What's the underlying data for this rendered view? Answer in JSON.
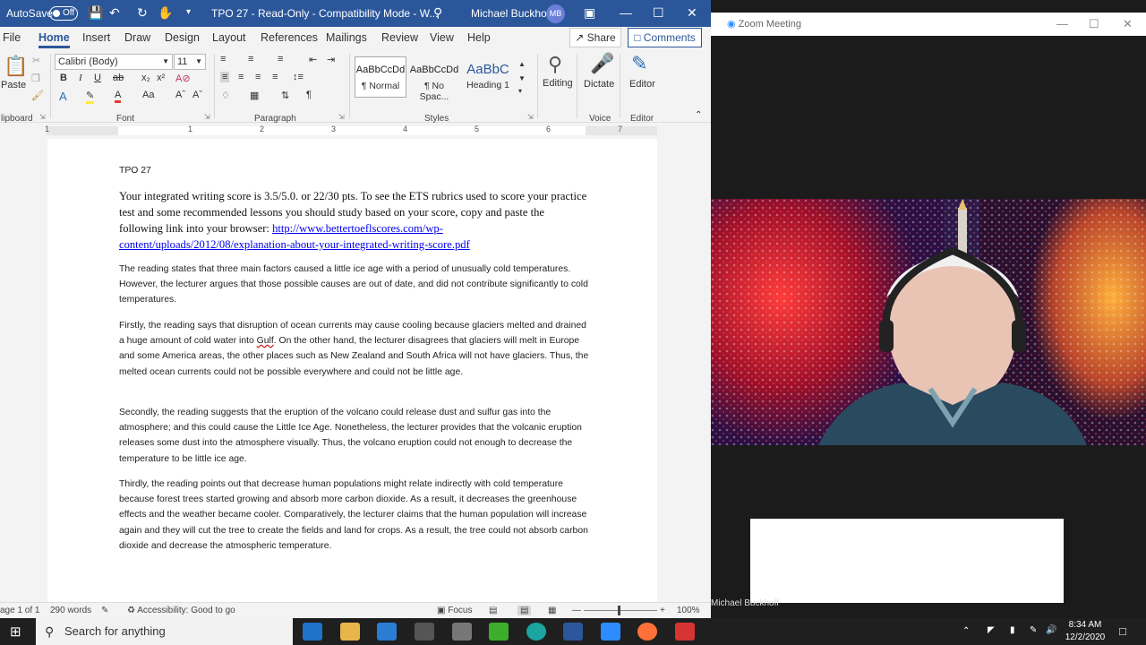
{
  "word": {
    "titlebar": {
      "autosave_label": "AutoSave",
      "autosave_state": "Off",
      "title": "TPO 27  -  Read-Only  -  Compatibility Mode  -  W...",
      "user": "Michael Buckhoff",
      "avatar_initials": "MB"
    },
    "menu": [
      "File",
      "Home",
      "Insert",
      "Draw",
      "Design",
      "Layout",
      "References",
      "Mailings",
      "Review",
      "View",
      "Help"
    ],
    "menu_active": "Home",
    "share_label": "Share",
    "comments_label": "Comments",
    "ribbon": {
      "paste_label": "Paste",
      "clipboard_label": "lipboard",
      "font_name": "Calibri (Body)",
      "font_size": "11",
      "font_group": "Font",
      "paragraph_group": "Paragraph",
      "styles_group": "Styles",
      "voice_group": "Voice",
      "editor_group": "Editor",
      "styles": [
        {
          "preview": "AaBbCcDd",
          "name": "¶ Normal"
        },
        {
          "preview": "AaBbCcDd",
          "name": "¶ No Spac..."
        },
        {
          "preview": "AaBbC",
          "name": "Heading 1"
        }
      ],
      "editing_label": "Editing",
      "dictate_label": "Dictate",
      "editor_label": "Editor"
    },
    "ruler_numbers": [
      "1",
      "1",
      "2",
      "3",
      "4",
      "5",
      "6",
      "7"
    ],
    "document": {
      "heading": "TPO 27",
      "intro_1": "Your integrated writing score is 3.5/5.0.  or 22/30 pts. To  see the ETS rubrics used to score your practice test and some recommended lessons you should study based on your score, copy and paste the following link into your browser: ",
      "intro_link": "http://www.bettertoeflscores.com/wp-content/uploads/2012/08/explanation-about-your-integrated-writing-score.pdf",
      "p1": "The reading states that three main factors caused a little ice age with a period of unusually cold temperatures. However, the lecturer argues that those possible causes are out of date, and  did not contribute significantly to cold temperatures.",
      "p2_a": "Firstly, the reading says that disruption of ocean currents may cause cooling because glaciers melted and drained a huge amount of cold water into ",
      "p2_misspelled": "Gulf",
      "p2_b": ". On the other hand, the lecturer disagrees that glaciers will melt in Europe and some America areas, the other places such as New Zealand and South Africa will not have glaciers. Thus, the melted ocean currents could not be possible everywhere and could not be little age.",
      "p3": "Secondly, the reading suggests that the eruption of the volcano could release dust and sulfur gas into the atmosphere; and this could cause the Little Ice Age. Nonetheless, the lecturer provides that the volcanic eruption releases some dust into the atmosphere visually. Thus, the volcano eruption could not enough to decrease the temperature to be little ice age.",
      "p4": "Thirdly, the reading points out that decrease human populations might relate indirectly with cold temperature because forest trees started growing and absorb more carbon dioxide. As a result, it decreases the greenhouse effects and the weather became cooler. Comparatively, the lecturer claims that the human population will increase again and they will cut the tree to create the fields and land for crops. As a result, the tree could not absorb carbon dioxide and decrease the atmospheric temperature."
    },
    "status": {
      "page": "age 1 of 1",
      "words": "290 words",
      "accessibility": "Accessibility: Good to go",
      "focus": "Focus",
      "zoom": "100%"
    }
  },
  "zoom": {
    "title": "Zoom Meeting",
    "participant": "Michael Buckhoff"
  },
  "taskbar": {
    "search_placeholder": "Search for anything",
    "time": "8:34 AM",
    "date": "12/2/2020"
  },
  "colors": {
    "word_blue": "#2b579a",
    "taskbar": "#1f1f1f"
  }
}
